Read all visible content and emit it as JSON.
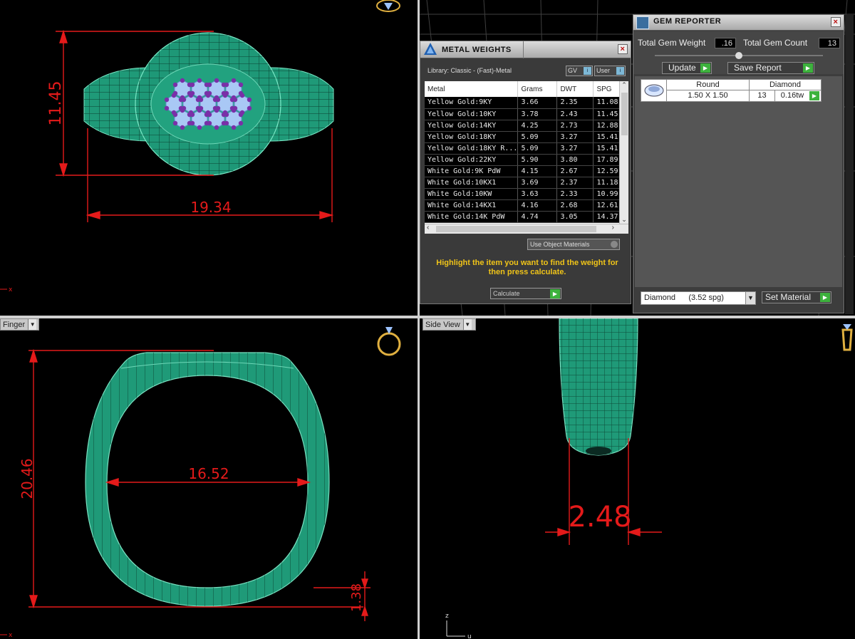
{
  "viewports": {
    "top": {
      "dims": {
        "height": "11.45",
        "width": "19.34"
      }
    },
    "front": {
      "label": "Finger",
      "dims": {
        "height": "20.46",
        "inner": "16.52",
        "thickness": "1.38"
      },
      "axis": {
        "z": "z",
        "x": "x"
      }
    },
    "side": {
      "label": "Side View",
      "dims": {
        "width": "2.48"
      },
      "axis": {
        "z": "z",
        "u": "u"
      }
    },
    "corner_marks": {
      "top_left": "x"
    }
  },
  "metal_weights": {
    "title": "METAL WEIGHTS",
    "library": "Library: Classic - (Fast)-Metal",
    "gv_label": "GV",
    "user_label": "User",
    "columns": [
      "Metal",
      "Grams",
      "DWT",
      "SPG"
    ],
    "rows": [
      [
        "Yellow Gold:9KY",
        "3.66",
        "2.35",
        "11.08"
      ],
      [
        "Yellow Gold:10KY",
        "3.78",
        "2.43",
        "11.45"
      ],
      [
        "Yellow Gold:14KY",
        "4.25",
        "2.73",
        "12.88"
      ],
      [
        "Yellow Gold:18KY",
        "5.09",
        "3.27",
        "15.41"
      ],
      [
        "Yellow Gold:18KY R...",
        "5.09",
        "3.27",
        "15.41"
      ],
      [
        "Yellow Gold:22KY",
        "5.90",
        "3.80",
        "17.89"
      ],
      [
        "White Gold:9K PdW",
        "4.15",
        "2.67",
        "12.59"
      ],
      [
        "White Gold:10KX1",
        "3.69",
        "2.37",
        "11.18"
      ],
      [
        "White Gold:10KW",
        "3.63",
        "2.33",
        "10.99"
      ],
      [
        "White Gold:14KX1",
        "4.16",
        "2.68",
        "12.61"
      ],
      [
        "White Gold:14K PdW",
        "4.74",
        "3.05",
        "14.37"
      ]
    ],
    "use_object_materials": "Use Object Materials",
    "hint": "Highlight the item you want to find the weight for then press calculate.",
    "calculate": "Calculate"
  },
  "gem_reporter": {
    "title": "GEM REPORTER",
    "total_weight_label": "Total Gem Weight",
    "total_weight": ".16",
    "total_count_label": "Total Gem Count",
    "total_count": "13",
    "update": "Update",
    "save_report": "Save Report",
    "gem": {
      "shape": "Round",
      "material": "Diamond",
      "size": "1.50 X 1.50",
      "count": "13",
      "weight": "0.16tw"
    },
    "material_select": "Diamond      (3.52 spg)",
    "set_material": "Set Material"
  },
  "colors": {
    "ring": "#1f9a78",
    "dim": "#e41a1a",
    "gem": "#a9c8f5",
    "prong": "#7a2fa8",
    "hint": "#f0c418",
    "go": "#3db23d"
  }
}
